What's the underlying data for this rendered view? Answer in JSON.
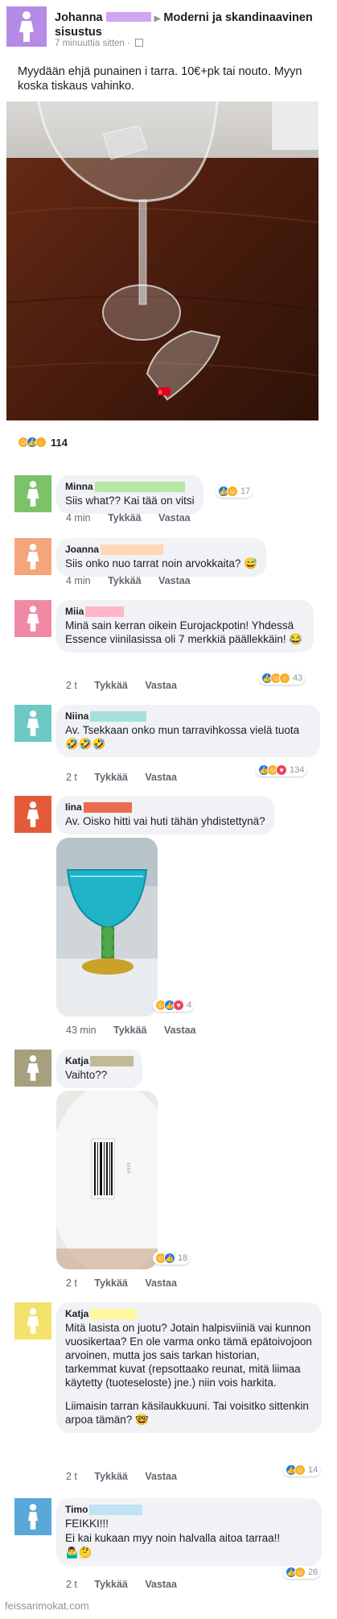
{
  "post": {
    "author": "Johanna",
    "arrow": "▶",
    "group": "Moderni ja skandinaavinen sisustus",
    "time": "7 minuuttia sitten ·",
    "text": "Myydään ehjä punainen i tarra. 10€+pk tai nouto. Myyn koska tiskaus vahinko.",
    "reactions_count": "114"
  },
  "colors": {
    "avatar_purple": "#b58be6",
    "avatar_green": "#7cc26a",
    "avatar_peach": "#f4a57b",
    "avatar_pink": "#f08aa4",
    "avatar_teal": "#6cc9c4",
    "avatar_red": "#e35a3a",
    "avatar_khaki": "#a89f7c",
    "avatar_yellow": "#f3e26b",
    "avatar_blue": "#5aa8d9",
    "redact_purple": "#d0a6f0",
    "redact_green": "#b8e6a6",
    "redact_peach": "#ffd7b8",
    "redact_pink": "#ffb7c9",
    "redact_teal": "#a7e0dd",
    "redact_red": "#ec6a4d",
    "redact_khaki": "#c2b995",
    "redact_yellow": "#fff79b",
    "redact_blue": "#bfe2f5"
  },
  "actions": {
    "like": "Tykkää",
    "reply": "Vastaa"
  },
  "comments": [
    {
      "name": "Minna",
      "text": "Siis what?? Kai tää on vitsi",
      "time": "4 min",
      "reacts": "17"
    },
    {
      "name": "Joanna",
      "text": "Siis onko nuo tarrat noin arvokkaita? 😅",
      "time": "4 min",
      "reacts": ""
    },
    {
      "name": "Miia",
      "text": "Minä sain kerran oikein Eurojackpotin! Yhdessä Essence viinilasissa oli 7 merkkiä päällekkäin! 😂",
      "time": "2 t",
      "reacts": "43"
    },
    {
      "name": "Niina",
      "text": "Av. Tsekkaan onko mun tarravihkossa vielä tuota 🤣🤣🤣",
      "time": "2 t",
      "reacts": "134"
    },
    {
      "name": "Iina",
      "text": "Av. Oisko hitti vai huti tähän yhdistettynä?",
      "time": "43 min",
      "reacts": "4"
    },
    {
      "name": "Katja",
      "text": "Vaihto??",
      "time": "2 t",
      "reacts": "18"
    },
    {
      "name": "Katja",
      "text": "Mitä lasista on juotu? Jotain halpisviiniä vai kunnon vuosikertaa? En ole varma onko tämä epätoivojoon arvoinen, mutta jos sais tarkan historian, tarkemmat kuvat (repsottaako reunat, mitä liimaa käytetty (tuoteseloste) jne.) niin vois harkita.",
      "text2": "Liimaisin tarran käsilaukkuuni. Tai voisitko sittenkin arpoa tämän? 🤓",
      "time": "2 t",
      "reacts": "14"
    },
    {
      "name": "Timo",
      "text": "FEIKKI!!!",
      "text2": "Ei kai kukaan myy noin halvalla aitoa tarraa!!",
      "text3": "🤷‍♂️🤔",
      "time": "2 t",
      "reacts": "26"
    }
  ],
  "watermark": "feissarimokat.com"
}
